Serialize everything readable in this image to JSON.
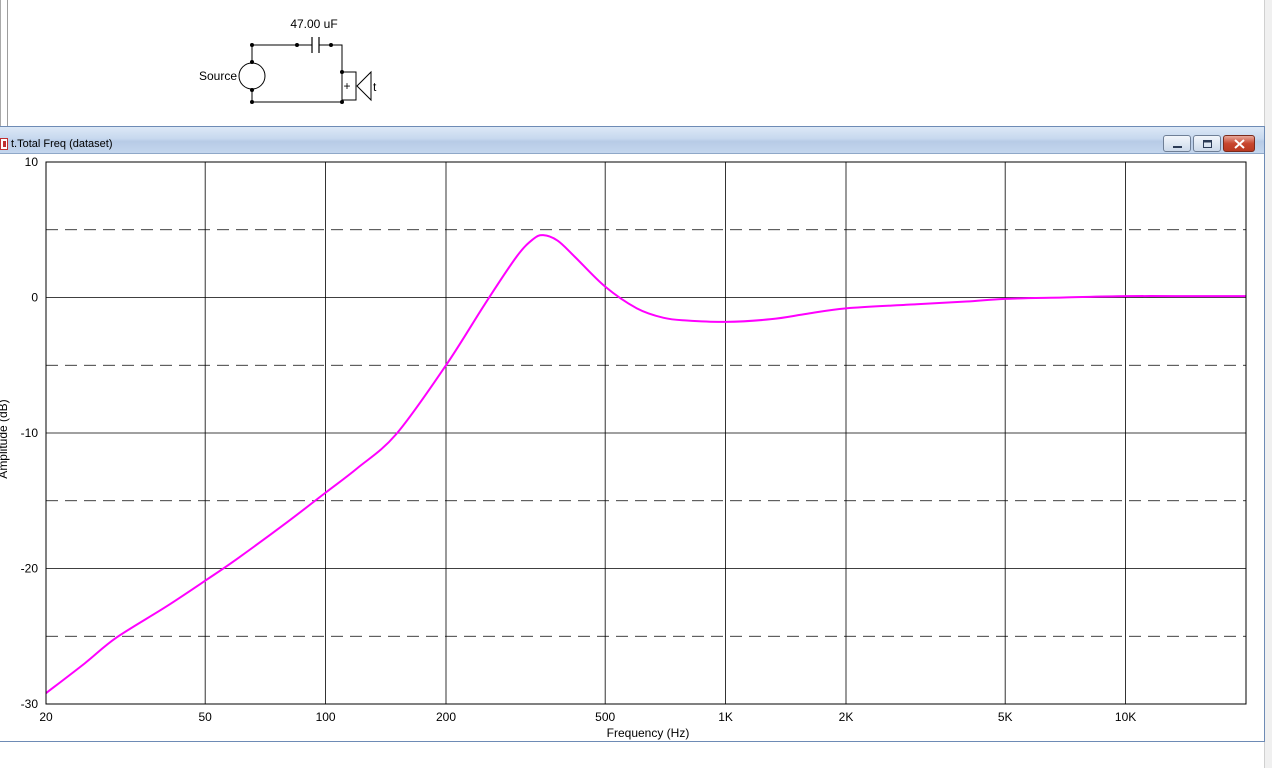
{
  "schematic": {
    "capacitor_label": "47.00 uF",
    "source_label": "Source",
    "speaker_plus": "+",
    "speaker_label": "t"
  },
  "window": {
    "title": "t.Total Freq (dataset)"
  },
  "colors": {
    "curve": "#ff00ff",
    "grid": "#000000",
    "titlebar": "#c7d8ee",
    "close_button": "#c8462f"
  },
  "chart_data": {
    "type": "line",
    "title": "",
    "xlabel": "Frequency (Hz)",
    "ylabel": "Amplitude (dB)",
    "xscale": "log",
    "xlim": [
      20,
      20000
    ],
    "ylim": [
      -30,
      10
    ],
    "x_ticks": [
      20,
      50,
      100,
      200,
      500,
      1000,
      2000,
      5000,
      10000
    ],
    "x_tick_labels": [
      "20",
      "50",
      "100",
      "200",
      "500",
      "1K",
      "2K",
      "5K",
      "10K"
    ],
    "y_ticks": [
      10,
      0,
      -10,
      -20,
      -30
    ],
    "y_tick_labels": [
      "10",
      "0",
      "-10",
      "-20",
      "-30"
    ],
    "dashed_y": [
      5,
      -5,
      -15,
      -25
    ],
    "grid": true,
    "series": [
      {
        "x": [
          20,
          25,
          30,
          40,
          50,
          60,
          80,
          100,
          120,
          150,
          200,
          250,
          300,
          330,
          350,
          380,
          420,
          500,
          600,
          700,
          800,
          1000,
          1300,
          1600,
          2000,
          3000,
          4000,
          5000,
          7000,
          10000,
          15000,
          20000
        ],
        "y": [
          -29.2,
          -27.0,
          -25.1,
          -22.8,
          -20.9,
          -19.3,
          -16.6,
          -14.4,
          -12.6,
          -10.1,
          -5.0,
          -0.5,
          3.0,
          4.3,
          4.6,
          4.2,
          3.0,
          0.8,
          -0.8,
          -1.5,
          -1.7,
          -1.8,
          -1.6,
          -1.2,
          -0.8,
          -0.5,
          -0.3,
          -0.1,
          0.0,
          0.1,
          0.1,
          0.1
        ]
      }
    ]
  }
}
